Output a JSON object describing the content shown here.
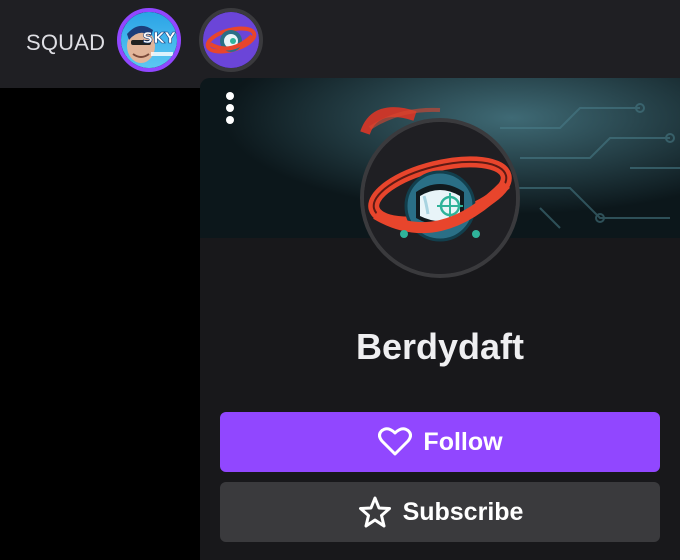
{
  "squad": {
    "label": "SQUAD",
    "members": [
      {
        "name": "sky",
        "avatar_text": "SKY",
        "ring_color": "#9147ff"
      },
      {
        "name": "berdydaft",
        "ring_color": "#3a3a3d"
      }
    ]
  },
  "card": {
    "menu_icon": "kebab-menu-icon",
    "profile_icon": "saturn-astronaut-logo",
    "channel_name": "Berdydaft",
    "follow": {
      "label": "Follow",
      "icon": "heart-icon",
      "color": "#9147ff"
    },
    "subscribe": {
      "label": "Subscribe",
      "icon": "star-icon",
      "color": "#3a3a3d"
    }
  }
}
